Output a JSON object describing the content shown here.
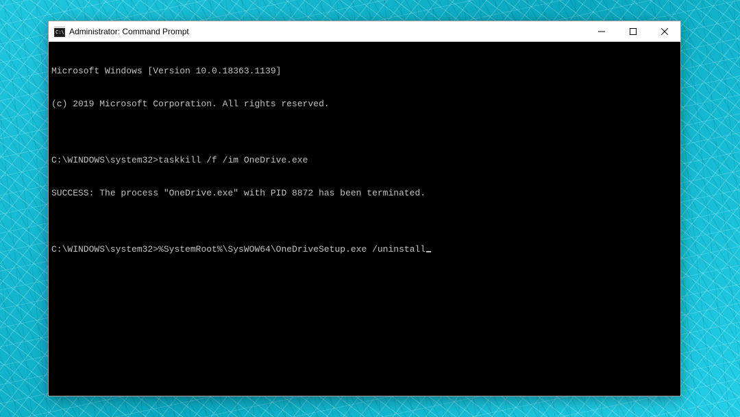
{
  "window": {
    "title": "Administrator: Command Prompt"
  },
  "terminal": {
    "lines": [
      "Microsoft Windows [Version 10.0.18363.1139]",
      "(c) 2019 Microsoft Corporation. All rights reserved.",
      "",
      "C:\\WINDOWS\\system32>taskkill /f /im OneDrive.exe",
      "SUCCESS: The process \"OneDrive.exe\" with PID 8872 has been terminated.",
      ""
    ],
    "current_prompt": "C:\\WINDOWS\\system32>",
    "current_input": "%SystemRoot%\\SysWOW64\\OneDriveSetup.exe /uninstall"
  }
}
